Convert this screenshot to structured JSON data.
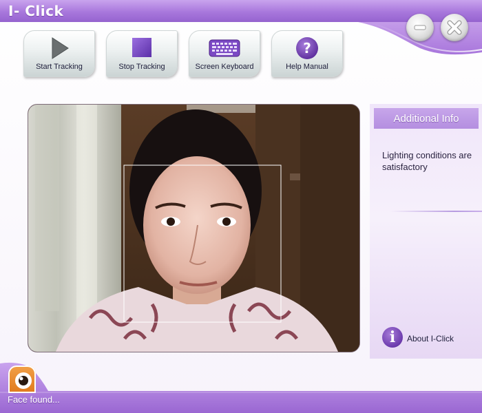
{
  "window": {
    "title": "I- Click",
    "minimize_icon": "minimize-icon",
    "close_icon": "close-icon",
    "accent_color": "#a877dc"
  },
  "toolbar": {
    "buttons": [
      {
        "label": "Start Tracking",
        "icon": "play-icon"
      },
      {
        "label": "Stop Tracking",
        "icon": "stop-icon"
      },
      {
        "label": "Screen Keyboard",
        "icon": "keyboard-icon"
      },
      {
        "label": "Help Manual",
        "icon": "question-icon"
      }
    ]
  },
  "camera": {
    "content": "webcam feed with face detection box",
    "face_box_color": "#ffffff"
  },
  "side_panel": {
    "title": "Additional Info",
    "message": "Lighting conditions are satisfactory",
    "about_label": "About I-Click",
    "about_icon": "info-icon"
  },
  "status": {
    "text": "Face found...",
    "tab_icon": "eye-icon"
  }
}
